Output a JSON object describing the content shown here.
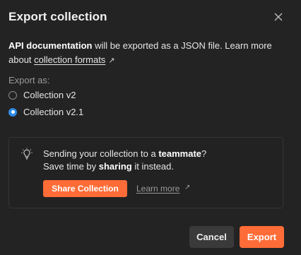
{
  "dialog": {
    "title": "Export collection",
    "description": {
      "collection_name": "API documentation",
      "text_1": " will be exported as a JSON file. Learn more about ",
      "link_label": "collection formats",
      "link_arrow": "↗"
    },
    "export_as_label": "Export as:",
    "options": [
      {
        "label": "Collection v2",
        "selected": false
      },
      {
        "label": "Collection v2.1",
        "selected": true
      }
    ],
    "tip_card": {
      "line1_text": "Sending your collection to a ",
      "line1_bold": "teammate",
      "line1_end": "?",
      "line2_text": "Save time by ",
      "line2_bold": "sharing",
      "line2_end": " it instead.",
      "share_button": "Share Collection",
      "learn_more": "Learn more",
      "learn_more_arrow": "↗"
    },
    "buttons": {
      "cancel": "Cancel",
      "export": "Export"
    }
  },
  "colors": {
    "background": "#232323",
    "accent": "#ff6c37",
    "radio_selected": "#2f8be6",
    "secondary_button": "#3a3a3a"
  },
  "icons": {
    "close": "close-icon",
    "bulb": "lightbulb-icon",
    "external": "external-link-icon"
  }
}
